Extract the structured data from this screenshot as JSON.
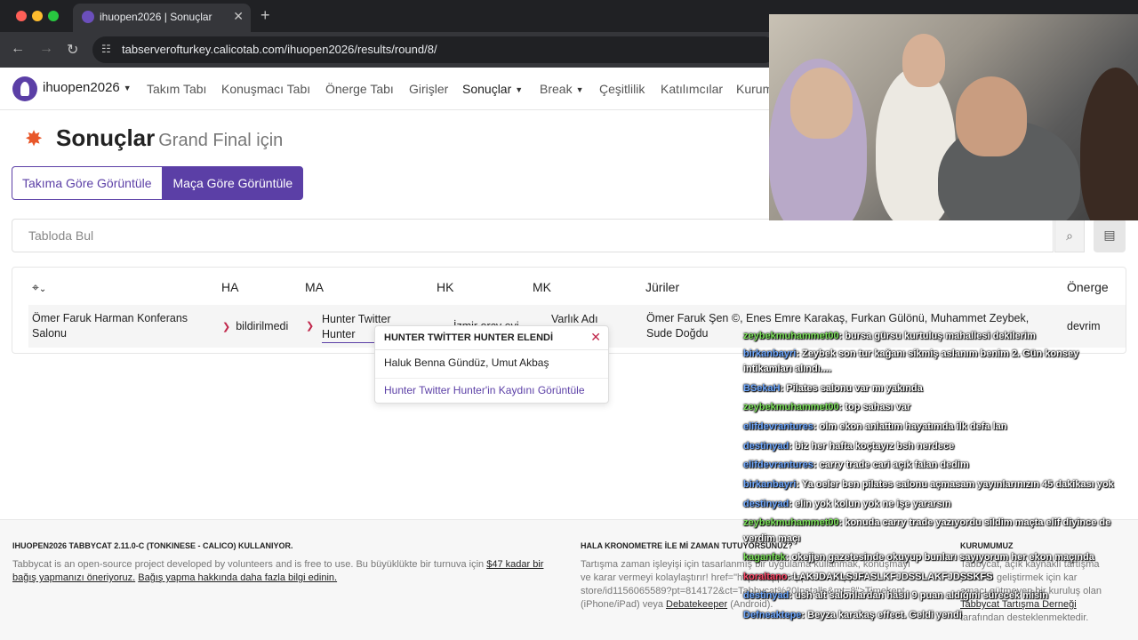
{
  "browser": {
    "tab_title": "ihuopen2026 | Sonuçlar",
    "url": "tabserverofturkey.calicotab.com/ihuopen2026/results/round/8/"
  },
  "navbar": {
    "brand": "ihuopen2026",
    "items": [
      "Takım Tabı",
      "Konuşmacı Tabı",
      "Önerge Tabı",
      "Girişler",
      "Sonuçlar",
      "Break",
      "Çeşitlilik",
      "Katılımcılar",
      "Kurum"
    ]
  },
  "page": {
    "title": "Sonuçlar",
    "subtitle": "Grand Final için",
    "btn_team": "Takıma Göre Görüntüle",
    "btn_match": "Maça Göre Görüntüle",
    "search_placeholder": "Tabloda Bul"
  },
  "table": {
    "headers": [
      "HA",
      "MA",
      "HK",
      "MK",
      "Jüriler",
      "Önerge"
    ],
    "row": {
      "venue": "Ömer Faruk Harman Konferans Salonu",
      "ha": "bildirilmedi",
      "ma": "Hunter Twitter Hunter",
      "hk": "İzmir orcy evi",
      "mk": "Varlık Adı",
      "juries": "Ömer Faruk Şen ©, Enes Emre Karakaş, Furkan Gülönü, Muhammet Zeybek, Sude Doğdu",
      "motion": "devrim"
    }
  },
  "popover": {
    "title": "HUNTER TWİTTER HUNTER ELENDİ",
    "members": "Haluk Benna Gündüz, Umut Akbaş",
    "link": "Hunter Twitter Hunter'in Kaydını Görüntüle"
  },
  "footer": {
    "col1_title": "IHUOPEN2026 TABBYCAT 2.11.0-C (TONKINESE - CALICO) KULLANIYOR.",
    "col1_text": "Tabbycat is an open-source project developed by volunteers and is free to use. Bu büyüklükte bir turnuva için",
    "col1_amount": "$47 kadar bir bağış yapmanızı öneriyoruz.",
    "col1_link": "Bağış yapma hakkında daha fazla bilgi edinin.",
    "col2_title": "HALA KRONOMETRE İLE Mİ ZAMAN TUTUYORSUNUZ?",
    "col2_line1": "Tartışma zaman işleyişi için tasarlanmış bir uygulama kullanmak, konuşmayı",
    "col2_line2": "ve karar vermeyi kolaylaştırır! href=\"https://apps.apple.com/app/id",
    "col2_line3": "store/id1156065589?pt=814172&ct=Tabbycat%20Installs&mt=8\">Timekept",
    "col2_line4": "(iPhone/iPad) veya",
    "col2_link": "Debatekeeper",
    "col2_line4b": "(Android).",
    "col3_title": "KURUMUMUZ",
    "col3_line1": "Tabbycat, açık kaynaklı tartışma",
    "col3_line2": "yazılımı geliştirmek için kar",
    "col3_line3": "amacı gütmeyen bir kuruluş olan",
    "col3_link": "Tabbycat Tartışma Derneği",
    "col3_line4": "tarafından desteklenmektedir."
  },
  "chat": [
    {
      "user": "zeybekmuhammet00",
      "color": "green",
      "text": ": bursa gürsu kurtuluş mahallesi dekilerim"
    },
    {
      "user": "birkanbayri",
      "color": "blue",
      "text": ": Zeybek son tur kağanı sikmiş aslanım benim 2. Gün konsey"
    },
    {
      "user": "",
      "color": "blue",
      "text": "intikamları alındı...."
    },
    {
      "user": "BSekaH",
      "color": "blue",
      "text": ": Pilates salonu var mı yakında"
    },
    {
      "user": "zeybekmuhammet00",
      "color": "green",
      "text": ": top sahası var"
    },
    {
      "user": "elifdevrantures",
      "color": "blue",
      "text": ": olm ekon anlattım hayatımda ilk defa lan"
    },
    {
      "user": "destinyad",
      "color": "blue",
      "text": ": biz her hafta koçtayız bsh nerdece"
    },
    {
      "user": "elifdevrantures",
      "color": "blue",
      "text": ": carry trade cari açık falan dedim"
    },
    {
      "user": "birkanbayri",
      "color": "blue",
      "text": ": Ya oeler ben pilates salonu açmasam yayınlarınızın 45 dakikası yok"
    },
    {
      "user": "destinyad",
      "color": "blue",
      "text": ": elin yok kolun yok ne işe yararsın"
    },
    {
      "user": "zeybekmuhammet00",
      "color": "green",
      "text": ": konuda carry trade yazıyordu sildim maçta elif diyince de"
    },
    {
      "user": "",
      "color": "green",
      "text": "verdim maçı"
    },
    {
      "user": "kaganfek",
      "color": "green",
      "text": ": okejjen gazetesinde okuyup bunları sayıyorum her ekon maçında"
    },
    {
      "user": "koraltano",
      "color": "red",
      "text": ": LAKJDAKLSJFASLKFJDSSLAKFJDSSKFS"
    },
    {
      "user": "destinyad",
      "color": "blue",
      "text": ": ush alt salonlardan hasıl 9 puan aldığını sürecek misin"
    },
    {
      "user": "Defneaktepe",
      "color": "blue",
      "text": ": Beyza karakaş effect. Geldi yendi"
    }
  ]
}
